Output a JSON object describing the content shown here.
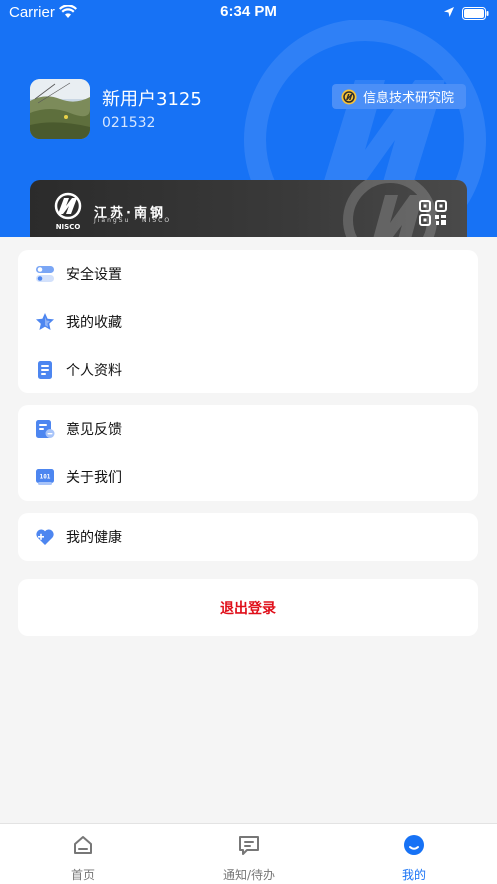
{
  "status_bar": {
    "carrier": "Carrier",
    "time": "6:34 PM"
  },
  "profile": {
    "name": "新用户3125",
    "id": "021532",
    "org": "信息技术研究院"
  },
  "card": {
    "brand": "江苏·南钢",
    "brand_sub": "JiangSu · NISCO",
    "logo_text": "NISCO"
  },
  "menu_groups": [
    [
      {
        "label": "安全设置",
        "icon": "toggle-settings-icon"
      },
      {
        "label": "我的收藏",
        "icon": "star-icon"
      },
      {
        "label": "个人资料",
        "icon": "profile-document-icon"
      }
    ],
    [
      {
        "label": "意见反馈",
        "icon": "feedback-icon"
      },
      {
        "label": "关于我们",
        "icon": "about-icon"
      }
    ],
    [
      {
        "label": "我的健康",
        "icon": "heart-plus-icon"
      }
    ]
  ],
  "logout_label": "退出登录",
  "tabs": [
    {
      "label": "首页",
      "icon": "home-icon"
    },
    {
      "label": "通知/待办",
      "icon": "message-icon"
    },
    {
      "label": "我的",
      "icon": "user-smile-icon",
      "active": true
    }
  ],
  "colors": {
    "primary": "#1772f5",
    "danger": "#e00f1a",
    "icon_blue": "#4d86f0"
  }
}
